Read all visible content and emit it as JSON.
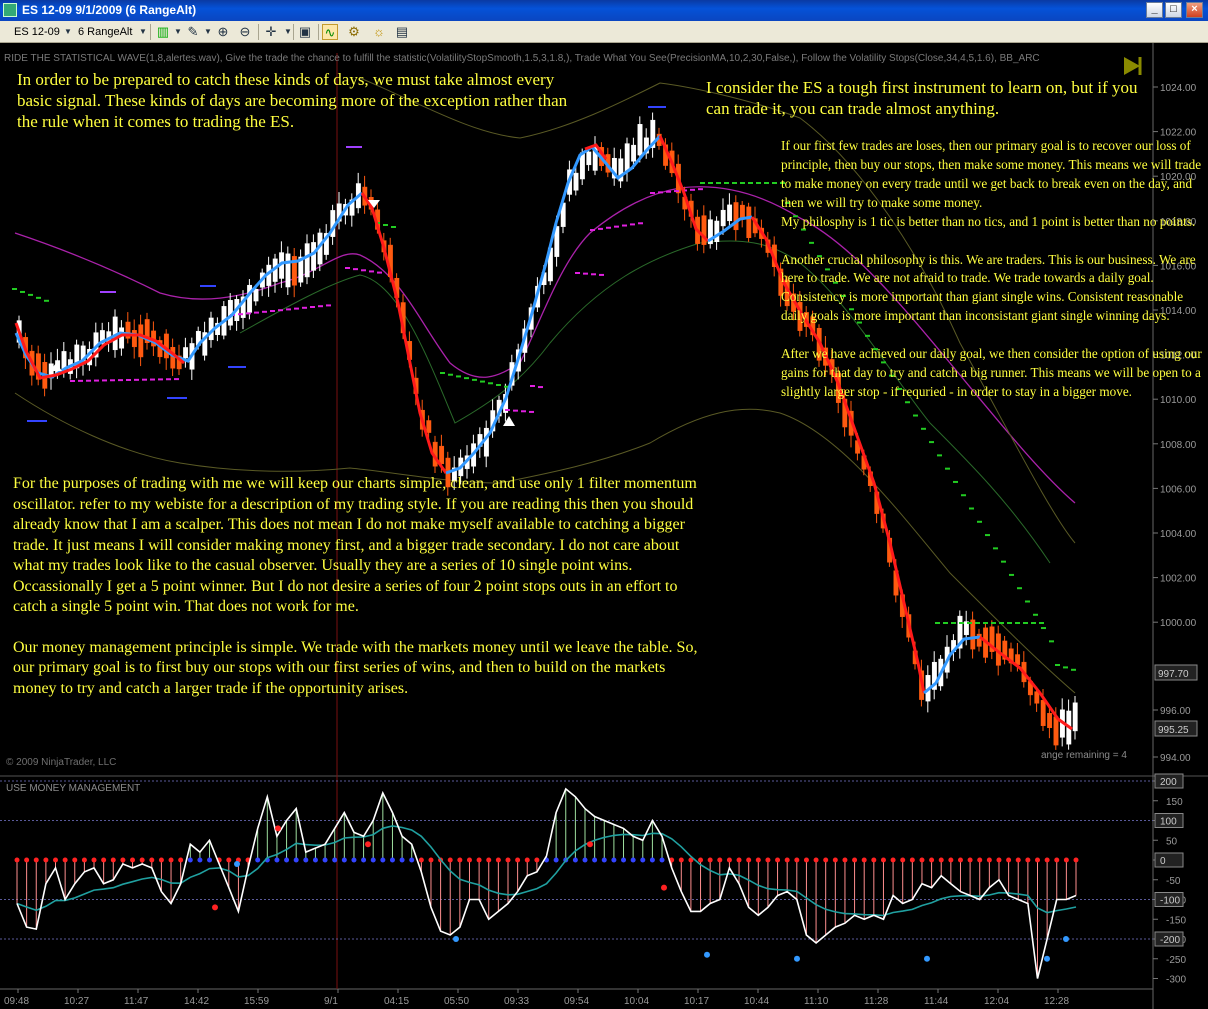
{
  "window": {
    "title": "ES 12-09  9/1/2009 (6 RangeAlt)",
    "buttons": [
      "_",
      "□",
      "×"
    ]
  },
  "toolbar": {
    "instrument": "ES 12-09",
    "period": "6 RangeAlt"
  },
  "chart": {
    "indicator_line": "RIDE THE STATISTICAL WAVE(1,8,alertes.wav), Give the trade the chance to fulfill the statistic(VolatilityStopSmooth,1.5,3,1.8,), Trade What You See(PrecisionMA,10,2,30,False,), Follow the Volatility Stops(Close,34,4,5,1.6), BB_ARC",
    "copyright": "© 2009 NinjaTrader, LLC",
    "range_remaining": "ange remaining = 4",
    "price_axis_labels": [
      "1024.00",
      "1022.00",
      "1020.00",
      "1018.00",
      "1016.00",
      "1014.00",
      "1012.00",
      "1010.00",
      "1008.00",
      "1006.00",
      "1004.00",
      "1002.00",
      "1000.00",
      "997.70",
      "996.00",
      "995.25",
      "994.00"
    ],
    "price_markers": [
      "997.70",
      "995.25"
    ],
    "oscillator_title": "USE MONEY MANAGEMENT",
    "oscillator_axis_labels": [
      "200",
      "150",
      "100",
      "50",
      "0",
      "-50",
      "-100",
      "-150",
      "-200",
      "-250",
      "-300"
    ],
    "oscillator_markers": [
      "200",
      "100",
      "0",
      "-100",
      "-200"
    ],
    "time_labels": [
      "09:48",
      "10:27",
      "11:47",
      "14:42",
      "15:59",
      "9/1",
      "04:15",
      "05:50",
      "09:33",
      "09:54",
      "10:04",
      "10:17",
      "10:44",
      "11:10",
      "11:28",
      "11:44",
      "12:04",
      "12:28"
    ],
    "colors": {
      "up_bar": "#ffffff",
      "down_bar": "#ff5a10",
      "ma_up": "#3399ff",
      "ma_down": "#ff1a1a",
      "stop_magenta": "#e020e0",
      "stop_green": "#22cc22",
      "note_text": "#ffff40"
    }
  },
  "notes": {
    "n1": "In order to be prepared to catch these kinds of days, we must take almost every basic signal. These kinds of days are becoming more of the exception rather than the rule when it comes to trading the ES.",
    "n2": "I consider the ES a tough first instrument to learn on, but if you can trade it, you can trade almost anything.",
    "n3a": "If our first few trades are loses, then our primary goal is to recover our loss of principle, then buy our stops, then make some money. This means we will trade to make money on every trade until we get back to break even on the day, and then we will try to make some money.",
    "n3b": "My philosphy is 1 tic is better than no tics, and 1 point is better than no points.",
    "n3c": "Another crucial philosophy is this. We are traders. This is our business. We are here to trade. We are not afraid to trade. We trade towards a daily goal.  Consistency is more important than giant single wins.  Consistent reasonable daily goals is more important than inconsistant giant single winning days.",
    "n3d": "After we have achieved our daily goal, we then consider the option of using our gains for that day to try and catch a big runner. This means we will be open to a slightly larger stop - if requried - in order to stay in a bigger move.",
    "n4a": "For the purposes of trading with me we will keep our charts simple, clean, and use only 1 filter momentum oscillator. refer to my webiste for a description of my trading style. If you are reading this then you should already know that I am a scalper.  This does not mean I do not make myself available to catching a bigger trade. It just means I will consider making money first, and a bigger trade secondary. I do not care about what my trades look like to the casual observer. Usually they are a series of 10 single point wins.  Occassionally I get a 5 point winner.  But I do not desire a series of four 2 point stops outs in an effort to catch a single 5 point win.  That does not work for me.",
    "n4b": "Our money management principle is simple. We trade with the markets money until we leave the table.  So, our primary goal is to first buy our stops with our first series of wins, and then to build on the markets money to try and catch a larger trade if the opportunity arises."
  }
}
